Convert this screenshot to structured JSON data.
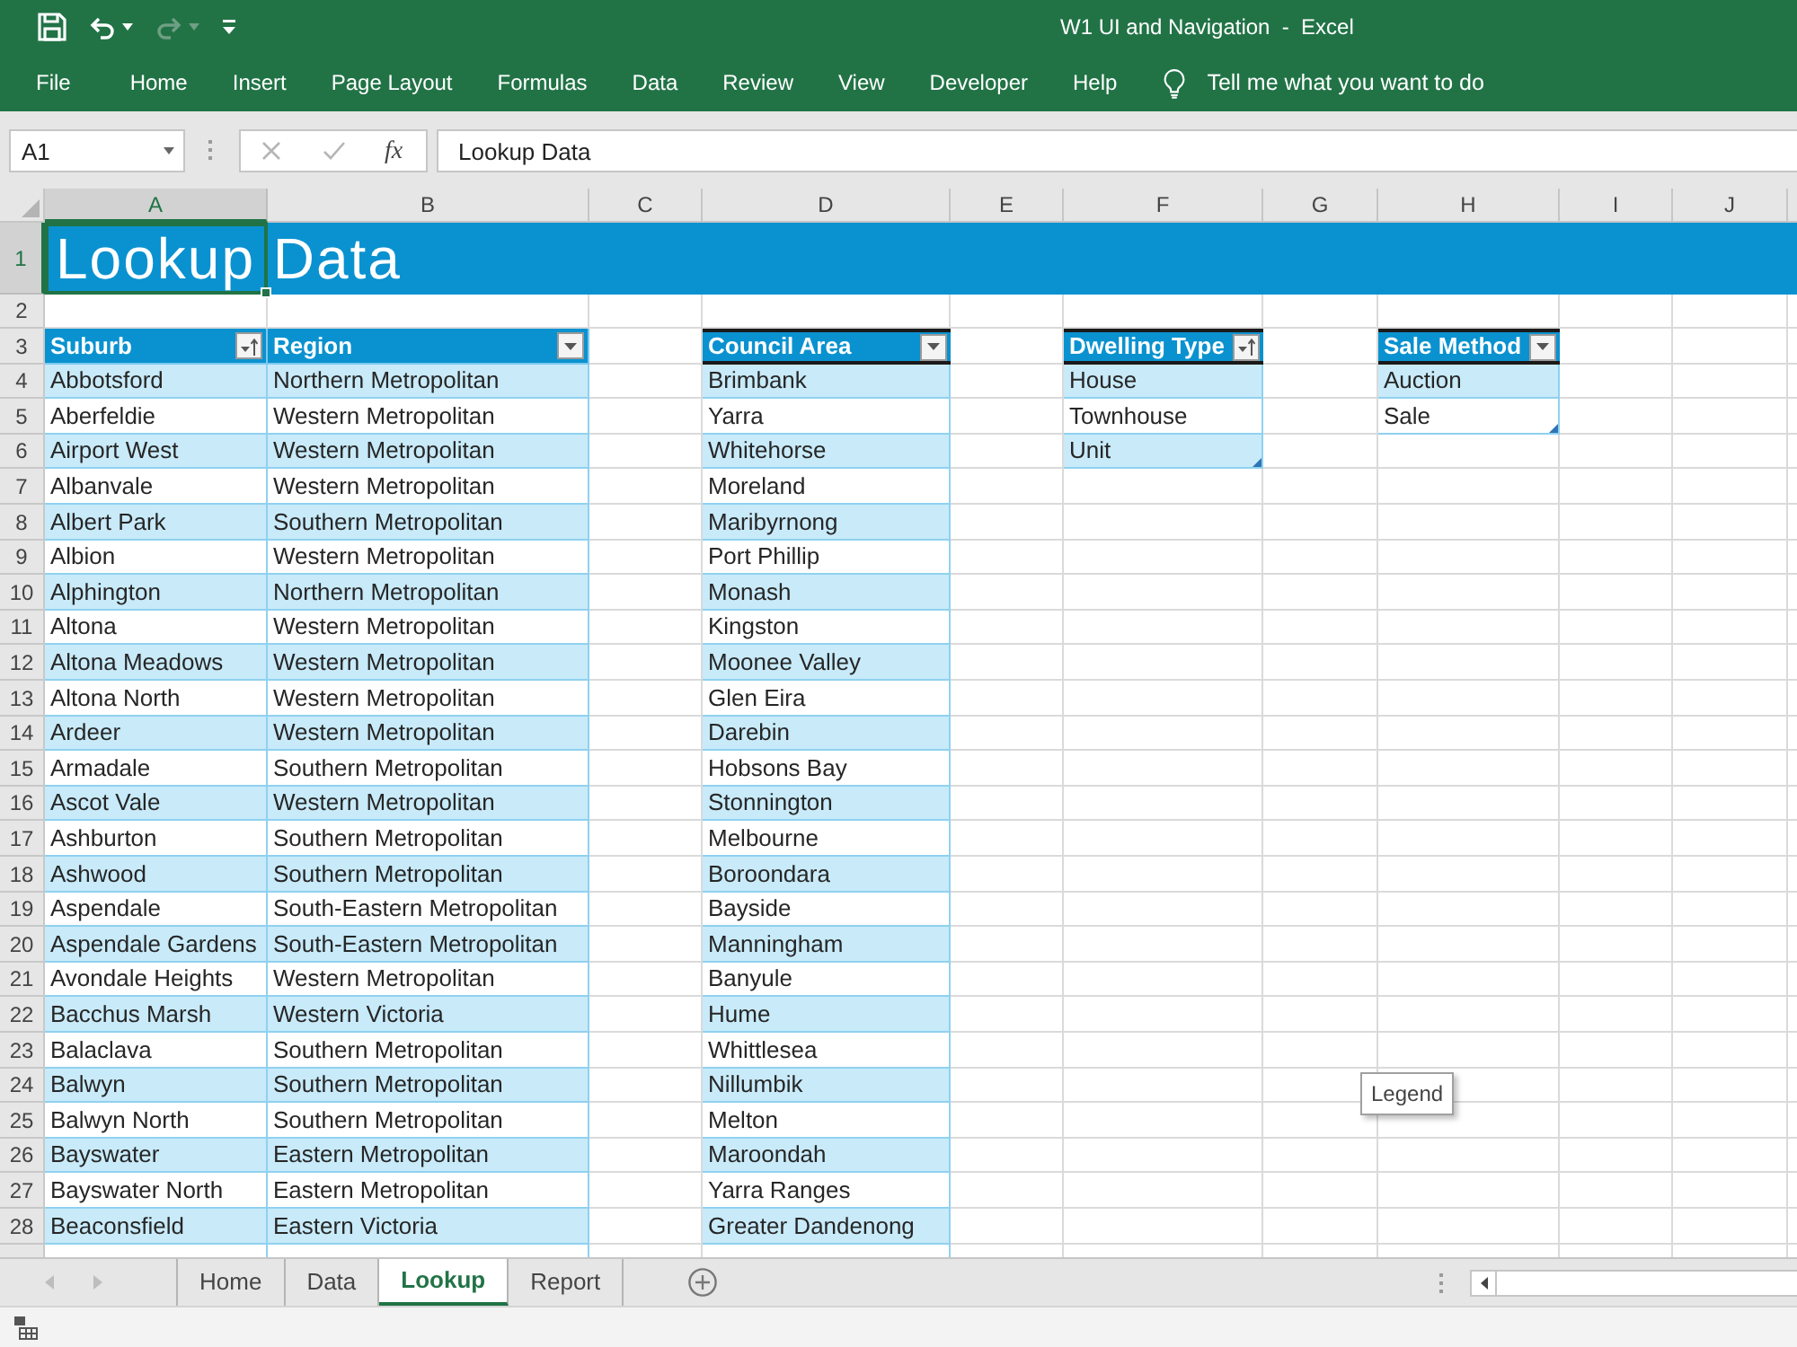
{
  "window": {
    "title": "W1 UI and Navigation  -  Excel"
  },
  "quick_access": [
    {
      "kind": "save",
      "disabled": false
    },
    {
      "kind": "undo",
      "disabled": false
    },
    {
      "kind": "redo",
      "disabled": true
    },
    {
      "kind": "customize",
      "disabled": false
    }
  ],
  "ribbon_tabs": [
    "File",
    "Home",
    "Insert",
    "Page Layout",
    "Formulas",
    "Data",
    "Review",
    "View",
    "Developer",
    "Help"
  ],
  "tell_me": {
    "placeholder": "Tell me what you want to do"
  },
  "formula_bar": {
    "name_box": "A1",
    "editing": false,
    "function_button": "fx",
    "formula": "Lookup Data"
  },
  "column_headers": [
    {
      "label": "A",
      "selected": true
    },
    {
      "label": "B",
      "selected": false
    },
    {
      "label": "C",
      "selected": false
    },
    {
      "label": "D",
      "selected": false
    },
    {
      "label": "E",
      "selected": false
    },
    {
      "label": "F",
      "selected": false
    },
    {
      "label": "G",
      "selected": false
    },
    {
      "label": "H",
      "selected": false
    },
    {
      "label": "I",
      "selected": false
    },
    {
      "label": "J",
      "selected": false
    }
  ],
  "rows": [
    {
      "label": "1",
      "selected": true
    },
    {
      "label": "2",
      "selected": false
    },
    {
      "label": "3",
      "selected": false
    },
    {
      "label": "4",
      "selected": false
    },
    {
      "label": "5",
      "selected": false
    },
    {
      "label": "6",
      "selected": false
    },
    {
      "label": "7",
      "selected": false
    },
    {
      "label": "8",
      "selected": false
    },
    {
      "label": "9",
      "selected": false
    },
    {
      "label": "10",
      "selected": false
    },
    {
      "label": "11",
      "selected": false
    },
    {
      "label": "12",
      "selected": false
    },
    {
      "label": "13",
      "selected": false
    },
    {
      "label": "14",
      "selected": false
    },
    {
      "label": "15",
      "selected": false
    },
    {
      "label": "16",
      "selected": false
    },
    {
      "label": "17",
      "selected": false
    },
    {
      "label": "18",
      "selected": false
    },
    {
      "label": "19",
      "selected": false
    },
    {
      "label": "20",
      "selected": false
    },
    {
      "label": "21",
      "selected": false
    },
    {
      "label": "22",
      "selected": false
    },
    {
      "label": "23",
      "selected": false
    },
    {
      "label": "24",
      "selected": false
    },
    {
      "label": "25",
      "selected": false
    },
    {
      "label": "26",
      "selected": false
    },
    {
      "label": "27",
      "selected": false
    },
    {
      "label": "28",
      "selected": false
    }
  ],
  "title_cell": {
    "text": "Lookup Data",
    "selected": true
  },
  "tables": [
    {
      "bordered_header": false,
      "continues": true,
      "columns": [
        {
          "header": "Suburb",
          "kind": "sort"
        },
        {
          "header": "Region",
          "kind": "dropdown"
        }
      ],
      "rows": [
        [
          "Abbotsford",
          "Northern Metropolitan"
        ],
        [
          "Aberfeldie",
          "Western Metropolitan"
        ],
        [
          "Airport West",
          "Western Metropolitan"
        ],
        [
          "Albanvale",
          "Western Metropolitan"
        ],
        [
          "Albert Park",
          "Southern Metropolitan"
        ],
        [
          "Albion",
          "Western Metropolitan"
        ],
        [
          "Alphington",
          "Northern Metropolitan"
        ],
        [
          "Altona",
          "Western Metropolitan"
        ],
        [
          "Altona Meadows",
          "Western Metropolitan"
        ],
        [
          "Altona North",
          "Western Metropolitan"
        ],
        [
          "Ardeer",
          "Western Metropolitan"
        ],
        [
          "Armadale",
          "Southern Metropolitan"
        ],
        [
          "Ascot Vale",
          "Western Metropolitan"
        ],
        [
          "Ashburton",
          "Southern Metropolitan"
        ],
        [
          "Ashwood",
          "Southern Metropolitan"
        ],
        [
          "Aspendale",
          "South-Eastern Metropolitan"
        ],
        [
          "Aspendale Gardens",
          "South-Eastern Metropolitan"
        ],
        [
          "Avondale Heights",
          "Western Metropolitan"
        ],
        [
          "Bacchus Marsh",
          "Western Victoria"
        ],
        [
          "Balaclava",
          "Southern Metropolitan"
        ],
        [
          "Balwyn",
          "Southern Metropolitan"
        ],
        [
          "Balwyn North",
          "Southern Metropolitan"
        ],
        [
          "Bayswater",
          "Eastern Metropolitan"
        ],
        [
          "Bayswater North",
          "Eastern Metropolitan"
        ],
        [
          "Beaconsfield",
          "Eastern Victoria"
        ]
      ]
    },
    {
      "bordered_header": true,
      "continues": true,
      "columns": [
        {
          "header": "Council Area",
          "kind": "dropdown"
        }
      ],
      "rows": [
        [
          "Brimbank"
        ],
        [
          "Yarra"
        ],
        [
          "Whitehorse"
        ],
        [
          "Moreland"
        ],
        [
          "Maribyrnong"
        ],
        [
          "Port Phillip"
        ],
        [
          "Monash"
        ],
        [
          "Kingston"
        ],
        [
          "Moonee Valley"
        ],
        [
          "Glen Eira"
        ],
        [
          "Darebin"
        ],
        [
          "Hobsons Bay"
        ],
        [
          "Stonnington"
        ],
        [
          "Melbourne"
        ],
        [
          "Boroondara"
        ],
        [
          "Bayside"
        ],
        [
          "Manningham"
        ],
        [
          "Banyule"
        ],
        [
          "Hume"
        ],
        [
          "Whittlesea"
        ],
        [
          "Nillumbik"
        ],
        [
          "Melton"
        ],
        [
          "Maroondah"
        ],
        [
          "Yarra Ranges"
        ],
        [
          "Greater Dandenong"
        ]
      ]
    },
    {
      "bordered_header": true,
      "continues": false,
      "columns": [
        {
          "header": "Dwelling Type",
          "kind": "sort"
        }
      ],
      "rows": [
        [
          "House"
        ],
        [
          "Townhouse"
        ],
        [
          "Unit"
        ]
      ]
    },
    {
      "bordered_header": true,
      "continues": false,
      "columns": [
        {
          "header": "Sale Method",
          "kind": "dropdown"
        }
      ],
      "rows": [
        [
          "Auction"
        ],
        [
          "Sale"
        ]
      ]
    }
  ],
  "tooltip": {
    "text": "Legend"
  },
  "sheet_tabs": [
    {
      "label": "Home",
      "selected": false
    },
    {
      "label": "Data",
      "selected": false
    },
    {
      "label": "Lookup",
      "selected": true
    },
    {
      "label": "Report",
      "selected": false
    }
  ]
}
